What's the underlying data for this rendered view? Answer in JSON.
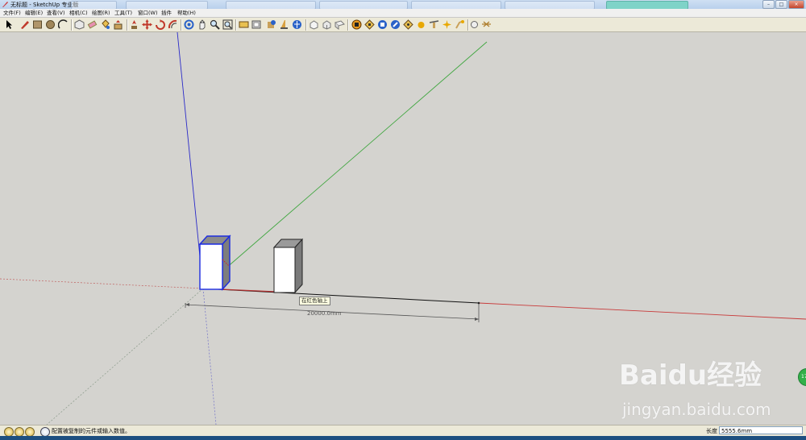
{
  "window": {
    "title": "无标题 - SketchUp 专业版",
    "controls": [
      "–",
      "□",
      "×"
    ]
  },
  "menu": [
    "文件(F)",
    "编辑(E)",
    "查看(V)",
    "相机(C)",
    "绘图(R)",
    "工具(T)",
    "窗口(W)",
    "插件",
    "帮助(H)"
  ],
  "toolbar": {
    "icons": [
      "select-icon",
      "pencil-icon",
      "rectangle-icon",
      "circle-icon",
      "arc-icon",
      "make-component-icon",
      "eraser-icon",
      "paint-bucket-icon",
      "push-pull-icon",
      "follow-me-icon",
      "move-icon",
      "rotate-icon",
      "offset-icon",
      "orbit-icon",
      "pan-icon",
      "zoom-icon",
      "zoom-extents-icon",
      "section-plane-icon",
      "tape-measure-icon",
      "dimension-icon",
      "protractor-icon",
      "axes-icon",
      "text-icon",
      "iso-view-icon",
      "top-view-icon",
      "front-view-icon",
      "right-view-icon",
      "back-view-icon",
      "left-view-icon",
      "xray-icon",
      "wireframe-icon",
      "hidden-line-icon",
      "shaded-icon",
      "shaded-texture-icon",
      "monochrome-icon",
      "shadow-icon",
      "fog-icon",
      "sun-icon"
    ]
  },
  "viewport": {
    "tooltip": "在红色轴上",
    "dimension": "20000.0mm",
    "axis_colors": {
      "red": "#c83a3a",
      "green": "#3fa63f",
      "blue": "#2a2ac8"
    }
  },
  "watermark": {
    "logo": "Baidu经验",
    "url": "jingyan.baidu.com"
  },
  "status": {
    "message": "配置被复制的元件或输入数值。",
    "length_label": "长度",
    "length_value": "5555.6mm"
  }
}
